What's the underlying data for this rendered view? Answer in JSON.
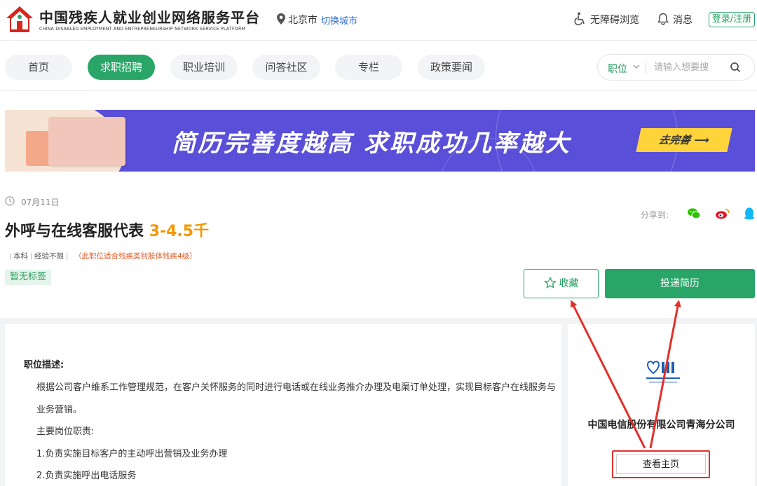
{
  "header": {
    "site_title": "中国残疾人就业创业网络服务平台",
    "site_subtitle": "CHINA DISABLED EMPLOYMENT AND ENTREPRENEURSHIP NETWORK SERVICE PLATFORM",
    "city": "北京市",
    "switch_city": "切换城市",
    "accessibility": "无障碍浏览",
    "messages": "消息",
    "login": "登录/注册"
  },
  "nav": {
    "items": [
      {
        "label": "首页",
        "active": false
      },
      {
        "label": "求职招聘",
        "active": true
      },
      {
        "label": "职业培训",
        "active": false
      },
      {
        "label": "问答社区",
        "active": false
      },
      {
        "label": "专栏",
        "active": false
      },
      {
        "label": "政策要闻",
        "active": false
      }
    ]
  },
  "search": {
    "category": "职位",
    "placeholder": "请输入想要搜"
  },
  "banner": {
    "text": "简历完善度越高   求职成功几率越大",
    "button": "去完善 ⟶"
  },
  "job": {
    "date": "07月11日",
    "title": "外呼与在线客服代表",
    "salary": "3-4.5千",
    "education": "本科",
    "experience": "经验不限",
    "disability_note": "（此职位适合残疾类别肢体残疾4级）",
    "tag": "暂无标签",
    "share_label": "分享到:",
    "favorite": "收藏",
    "apply": "投递简历"
  },
  "description": {
    "heading": "职位描述:",
    "lines": [
      "根据公司客户维系工作管理规范，在客户关怀服务的同时进行电话或在线业务推介办理及电渠订单处理，实现目标客户在线服务与",
      "业务营销。",
      "主要岗位职责:",
      "1.负责实施目标客户的主动呼出营销及业务办理",
      "2.负责实施呼出电话服务"
    ]
  },
  "company": {
    "name": "中国电信股份有限公司青海分公司",
    "view_home": "查看主页"
  },
  "colors": {
    "brand_green": "#2aa568",
    "salary_orange": "#f39800",
    "banner_purple": "#5a4fd8",
    "annotation_red": "#e3302a"
  }
}
